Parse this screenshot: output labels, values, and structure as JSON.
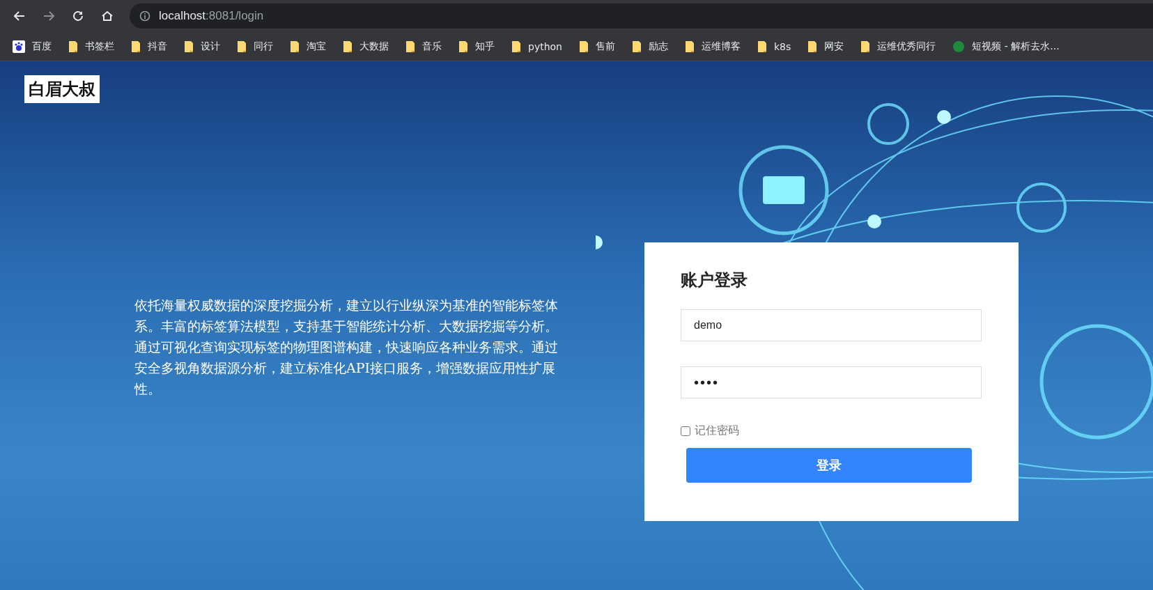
{
  "browser": {
    "address_host": "localhost",
    "address_path": ":8081/login",
    "bookmarks": [
      {
        "label": "百度",
        "kind": "site"
      },
      {
        "label": "书签栏",
        "kind": "folder"
      },
      {
        "label": "抖音",
        "kind": "folder"
      },
      {
        "label": "设计",
        "kind": "folder"
      },
      {
        "label": "同行",
        "kind": "folder"
      },
      {
        "label": "淘宝",
        "kind": "folder"
      },
      {
        "label": "大数据",
        "kind": "folder"
      },
      {
        "label": "音乐",
        "kind": "folder"
      },
      {
        "label": "知乎",
        "kind": "folder"
      },
      {
        "label": "python",
        "kind": "folder"
      },
      {
        "label": "售前",
        "kind": "folder"
      },
      {
        "label": "励志",
        "kind": "folder"
      },
      {
        "label": "运维博客",
        "kind": "folder"
      },
      {
        "label": "k8s",
        "kind": "folder"
      },
      {
        "label": "网安",
        "kind": "folder"
      },
      {
        "label": "运维优秀同行",
        "kind": "folder"
      },
      {
        "label": "短视频 - 解析去水...",
        "kind": "api"
      }
    ]
  },
  "logo": "白眉大叔",
  "intro": "依托海量权威数据的深度挖掘分析，建立以行业纵深为基准的智能标签体系。丰富的标签算法模型，支持基于智能统计分析、大数据挖掘等分析。通过可视化查询实现标签的物理图谱构建，快速响应各种业务需求。通过安全多视角数据源分析，建立标准化API接口服务，增强数据应用性扩展性。",
  "login": {
    "title": "账户登录",
    "username": "demo",
    "password": "••••",
    "remember": {
      "label": "记住密码",
      "checked": false
    },
    "submit": "登录"
  }
}
